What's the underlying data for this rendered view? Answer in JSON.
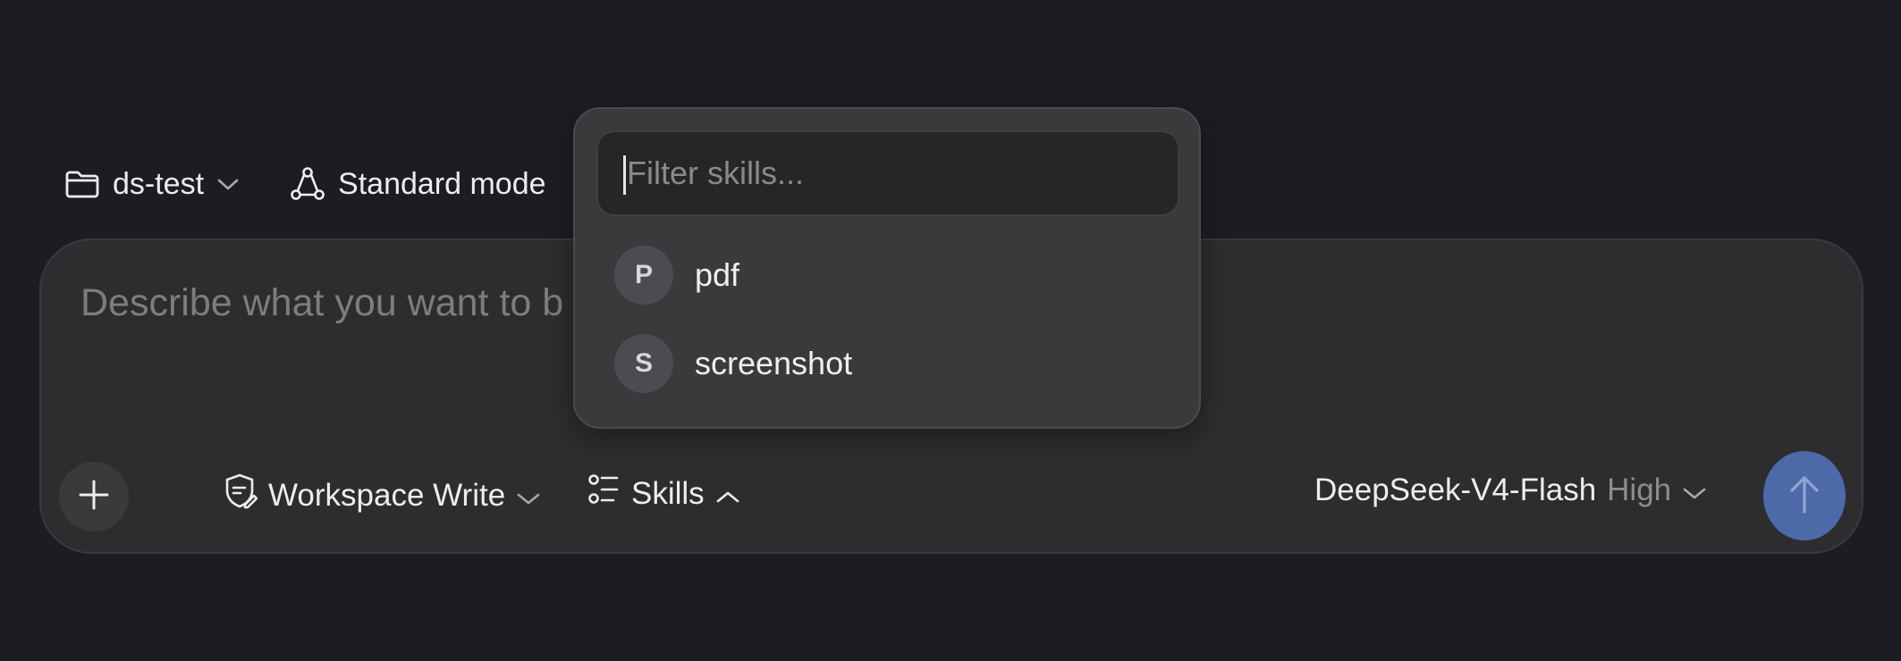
{
  "topbar": {
    "folder": {
      "label": "ds-test",
      "icon": "folder-icon"
    },
    "mode": {
      "label": "Standard mode",
      "icon": "nodes-icon"
    }
  },
  "composer": {
    "placeholder": "Describe what you want to b",
    "add_icon": "plus-icon",
    "permission": {
      "label": "Workspace Write",
      "icon": "shield-edit-icon"
    },
    "skills": {
      "label": "Skills",
      "icon": "list-icon"
    },
    "model": {
      "name": "DeepSeek-V4-Flash",
      "effort": "High"
    },
    "send_icon": "arrow-up-icon"
  },
  "skills_popover": {
    "filter_placeholder": "Filter skills...",
    "items": [
      {
        "badge": "P",
        "label": "pdf"
      },
      {
        "badge": "S",
        "label": "screenshot"
      }
    ]
  },
  "colors": {
    "background": "#1c1d22",
    "composer": "#2d2d30",
    "popover": "#3a3a3d",
    "send_button": "#4d6aa8"
  }
}
